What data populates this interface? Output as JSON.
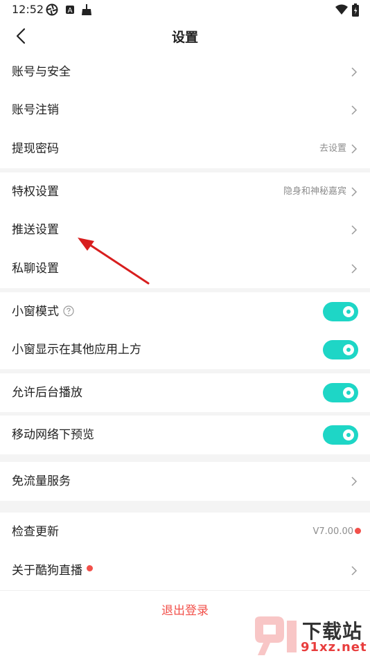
{
  "status_bar": {
    "time": "12:52"
  },
  "header": {
    "title": "设置"
  },
  "group1": [
    {
      "label": "账号与安全",
      "hint": ""
    },
    {
      "label": "账号注销",
      "hint": ""
    },
    {
      "label": "提现密码",
      "hint": "去设置"
    }
  ],
  "group2": [
    {
      "label": "特权设置",
      "hint": "隐身和神秘嘉宾"
    },
    {
      "label": "推送设置",
      "hint": ""
    },
    {
      "label": "私聊设置",
      "hint": ""
    }
  ],
  "toggles": {
    "mini_window": {
      "label": "小窗模式",
      "on": true
    },
    "overlay": {
      "label": "小窗显示在其他应用上方",
      "on": true
    },
    "background_play": {
      "label": "允许后台播放",
      "on": true
    },
    "mobile_preview": {
      "label": "移动网络下预览",
      "on": true
    }
  },
  "free_data": {
    "label": "免流量服务"
  },
  "check_update": {
    "label": "检查更新",
    "version": "V7.00.00"
  },
  "about": {
    "label": "关于酷狗直播"
  },
  "logout": {
    "label": "退出登录"
  },
  "watermark": {
    "top": "下载站",
    "bottom": "91xz.net"
  },
  "colors": {
    "accent": "#1ed6c6",
    "danger": "#f2504a",
    "section_gap": "#f4f4f4",
    "arrow": "#d81e1e"
  }
}
